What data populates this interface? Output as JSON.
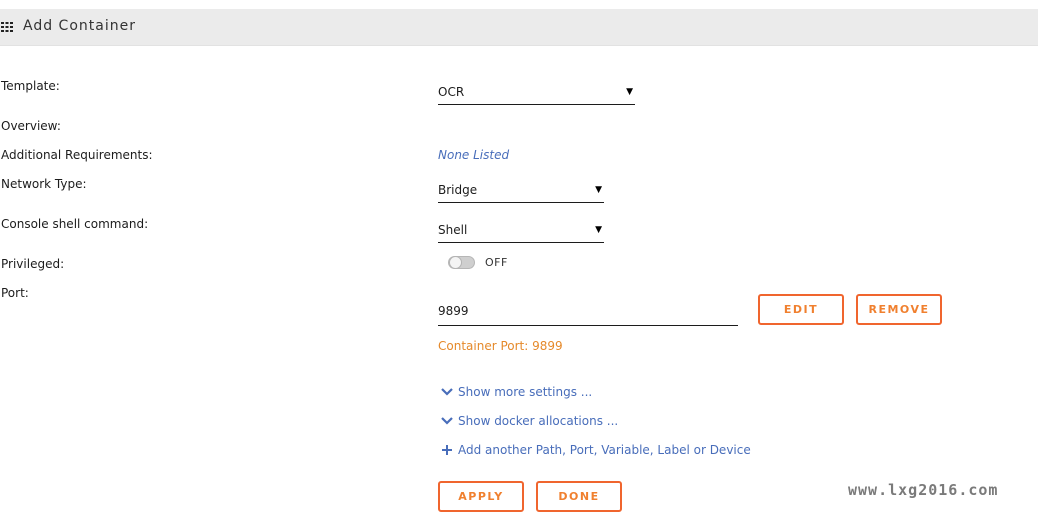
{
  "header": {
    "title": "Add Container",
    "icon": "grid-icon"
  },
  "form": {
    "template": {
      "label": "Template:",
      "value": "OCR"
    },
    "overview": {
      "label": "Overview:"
    },
    "requirements": {
      "label": "Additional Requirements:",
      "value": "None Listed"
    },
    "network": {
      "label": "Network Type:",
      "value": "Bridge"
    },
    "console": {
      "label": "Console shell command:",
      "value": "Shell"
    },
    "privileged": {
      "label": "Privileged:",
      "state": "OFF"
    },
    "port": {
      "label": "Port:",
      "value": "9899",
      "edit_label": "EDIT",
      "remove_label": "REMOVE",
      "container_port": "Container Port: 9899"
    }
  },
  "links": {
    "more_settings": "Show more settings ...",
    "docker_allocations": "Show docker allocations ...",
    "add_another": "Add another Path, Port, Variable, Label or Device"
  },
  "actions": {
    "apply_label": "APPLY",
    "done_label": "DONE"
  },
  "watermark": "www.lxg2016.com",
  "colors": {
    "accent": "#f0652e",
    "link": "#486dba",
    "info": "#e5892a",
    "header_bg": "#ebebeb"
  }
}
